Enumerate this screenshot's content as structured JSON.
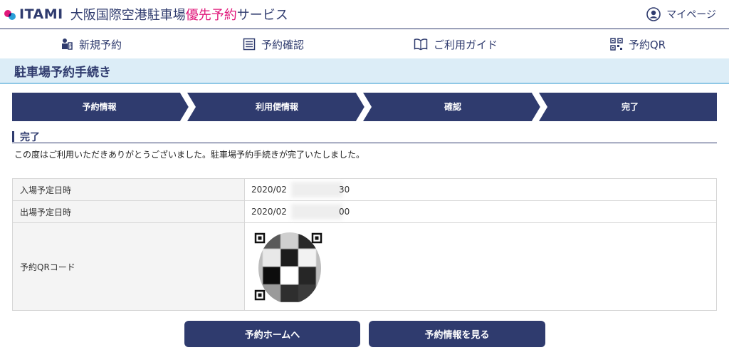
{
  "header": {
    "logo_text": "ITAMI",
    "site_title_pre": "大阪国際空港駐車場",
    "site_title_highlight": "優先予約",
    "site_title_post": "サービス",
    "mypage_label": "マイページ"
  },
  "nav": {
    "items": [
      {
        "label": "新規予約",
        "icon": "parking-person-icon"
      },
      {
        "label": "予約確認",
        "icon": "list-icon"
      },
      {
        "label": "ご利用ガイド",
        "icon": "book-icon"
      },
      {
        "label": "予約QR",
        "icon": "qr-code-icon"
      }
    ]
  },
  "page": {
    "title": "駐車場予約手続き"
  },
  "steps": [
    "予約情報",
    "利用便情報",
    "確認",
    "完了"
  ],
  "section": {
    "heading": "完了",
    "message": "この度はご利用いただきありがとうございました。駐車場予約手続きが完了いたしました。"
  },
  "table": {
    "rows": [
      {
        "label": "入場予定日時",
        "value_start": "2020/02",
        "value_end": "30"
      },
      {
        "label": "出場予定日時",
        "value_start": "2020/02",
        "value_end": "00"
      },
      {
        "label": "予約QRコード"
      }
    ]
  },
  "buttons": {
    "home": "予約ホームへ",
    "view": "予約情報を見る"
  },
  "colors": {
    "navy": "#2f3b6e",
    "accent": "#e0177a",
    "title_bg": "#dcedf7"
  }
}
